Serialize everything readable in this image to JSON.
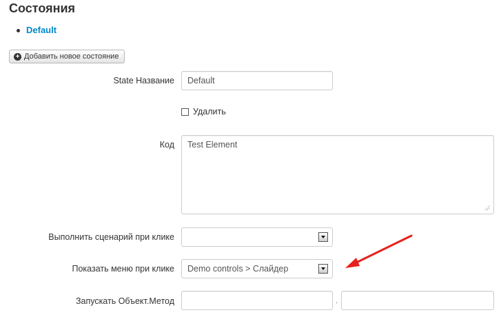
{
  "section": {
    "title": "Состояния"
  },
  "states": [
    {
      "label": "Default"
    }
  ],
  "toolbar": {
    "add_state_label": "Добавить новое состояние",
    "add_icon": "plus-circle-icon"
  },
  "form": {
    "state_name_label": "State Название",
    "state_name_value": "Default",
    "delete_label": "Удалить",
    "delete_checked": false,
    "code_label": "Код",
    "code_value": "Test Element",
    "script_label": "Выполнить сценарий при клике",
    "script_value": "",
    "menu_label": "Показать меню при клике",
    "menu_value": "Demo controls > Слайдер",
    "method_label": "Запускать Объект.Метод",
    "object_value": "",
    "method_separator": ".",
    "method_value": ""
  },
  "colors": {
    "link": "#0088cc",
    "annotation_arrow": "#e8201c"
  }
}
